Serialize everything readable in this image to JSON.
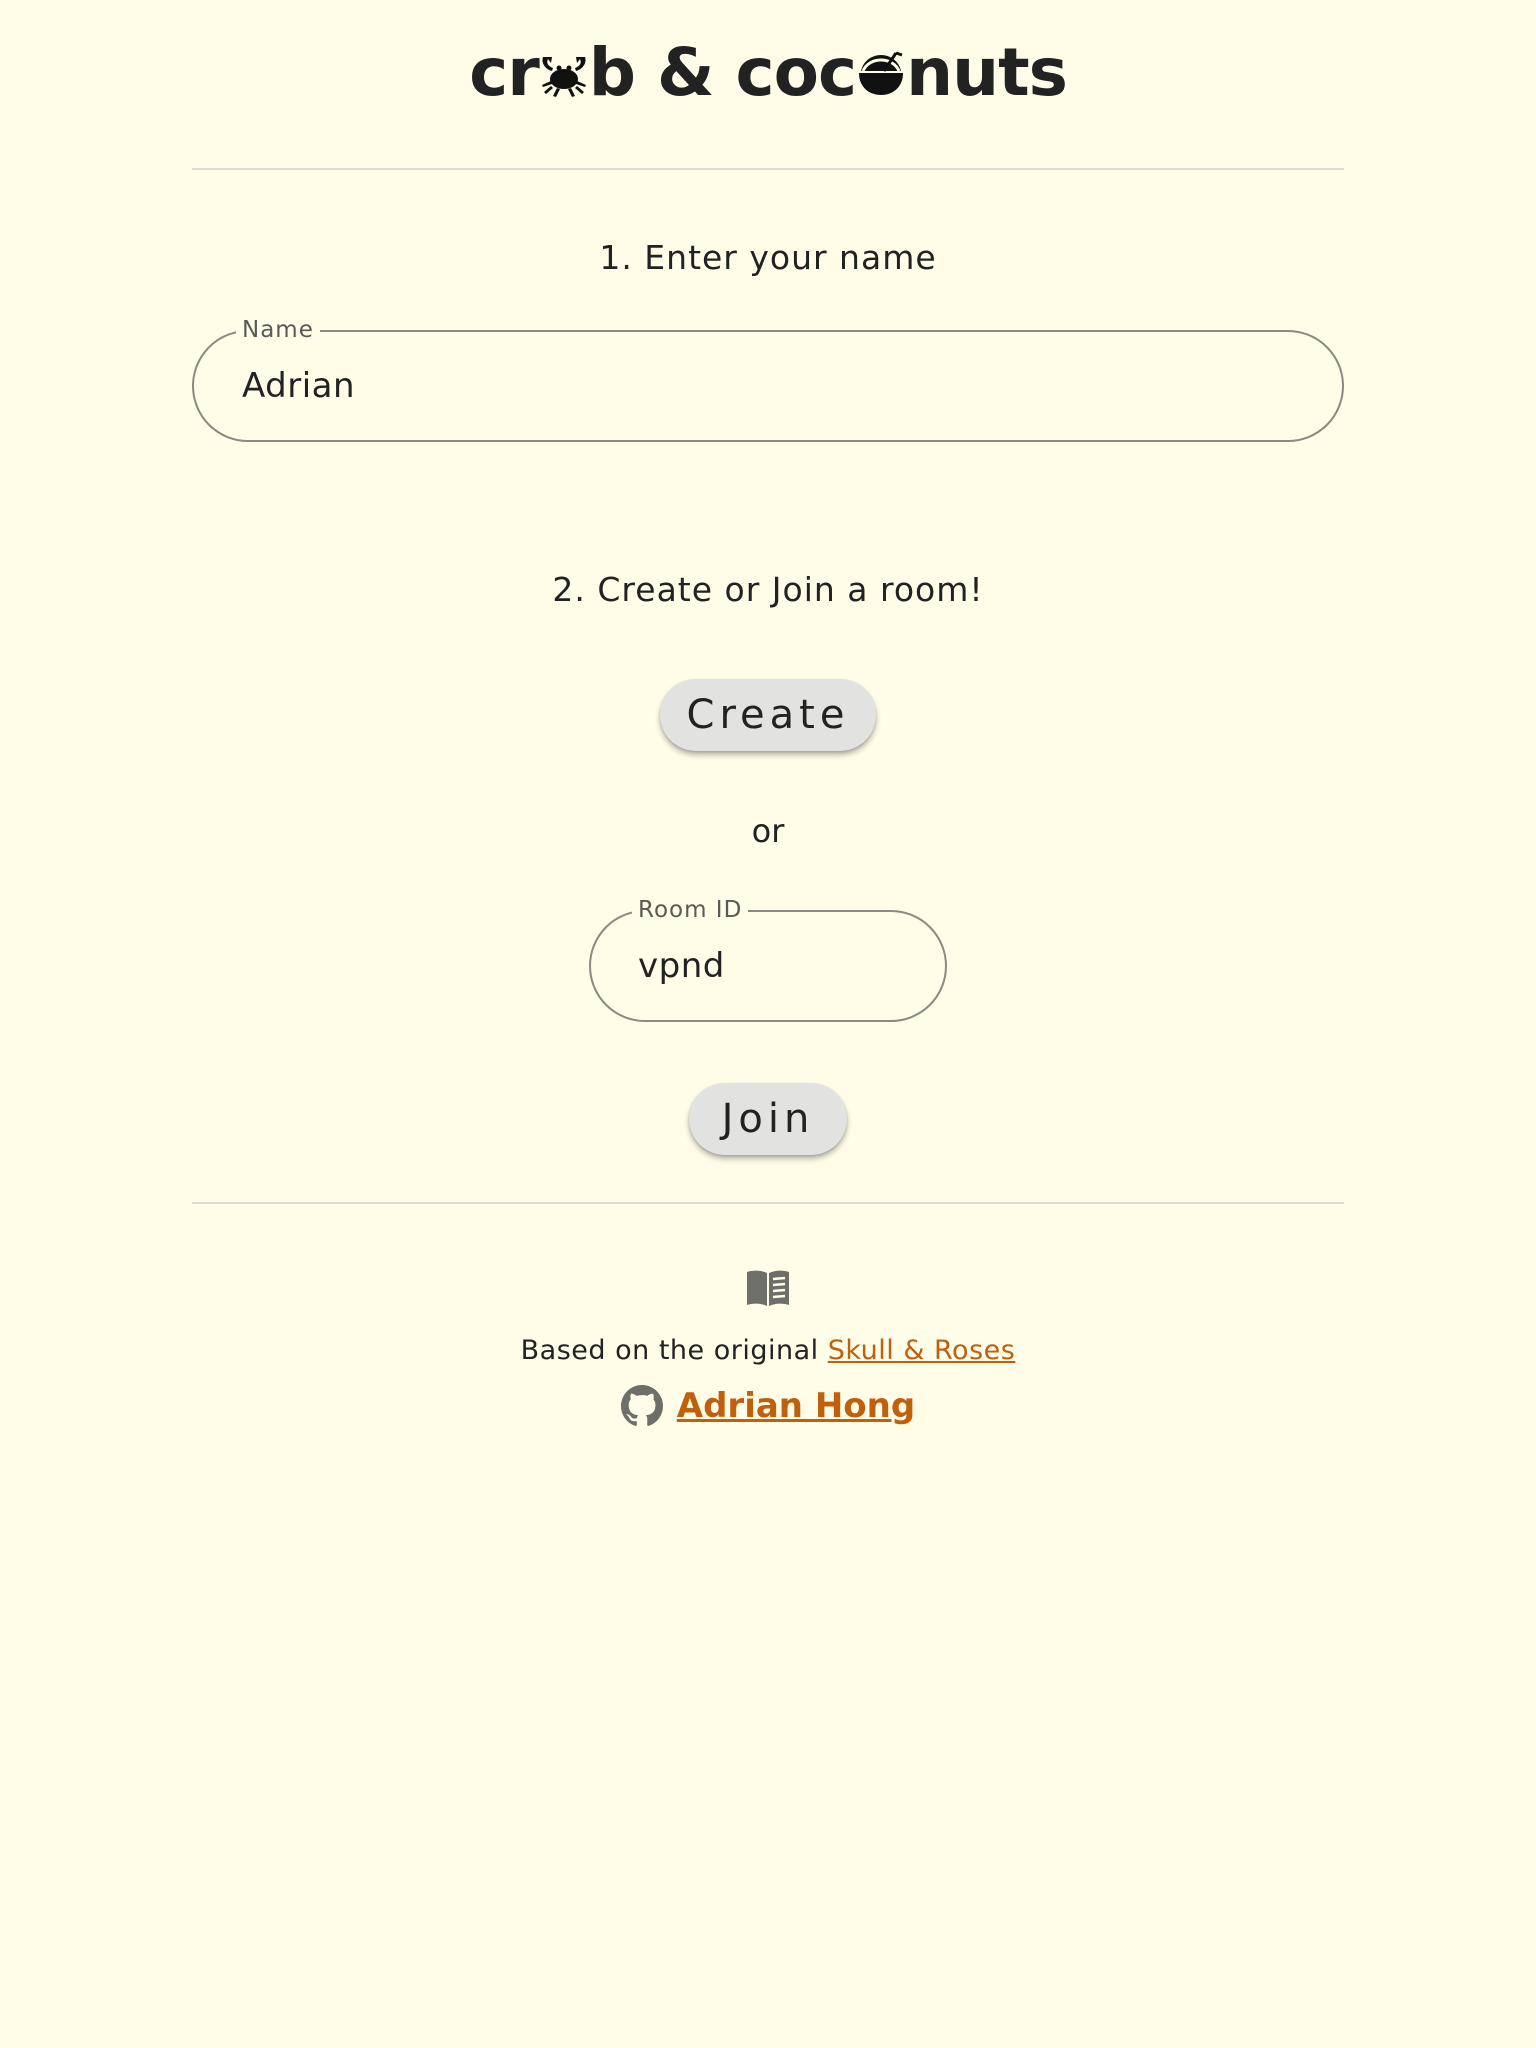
{
  "header": {
    "title_part1": "cr",
    "title_part2": "b & coc",
    "title_part3": "nuts",
    "title_icons": [
      "crab-icon",
      "coconut-icon"
    ]
  },
  "step1": {
    "heading": "1. Enter your name",
    "name_field": {
      "label": "Name",
      "value": "Adrian"
    }
  },
  "step2": {
    "heading": "2. Create or Join a room!",
    "create_label": "Create",
    "or_label": "or",
    "room_field": {
      "label": "Room ID",
      "value": "vpnd"
    },
    "join_label": "Join"
  },
  "footer": {
    "rules_icon": "book-icon",
    "credit_prefix": "Based on the original ",
    "credit_link": "Skull & Roses",
    "author_icon": "github-icon",
    "author_link": "Adrian Hong"
  },
  "colors": {
    "background": "#fffde8",
    "text": "#222222",
    "link": "#c0600c",
    "button": "#e2e2e0",
    "field_border": "#8a8a80"
  }
}
